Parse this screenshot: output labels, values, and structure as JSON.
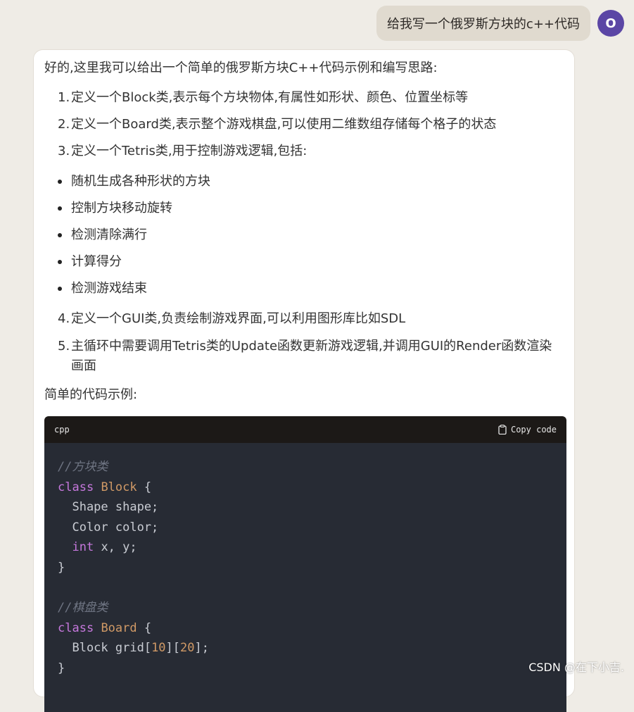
{
  "user_message": {
    "text": "给我写一个俄罗斯方块的c++代码",
    "avatar_initial": "O",
    "avatar_color": "#5b46a5"
  },
  "assistant": {
    "intro": "好的,这里我可以给出一个简单的俄罗斯方块C++代码示例和编写思路:",
    "ordered_items_a": [
      {
        "num": "1.",
        "text": "定义一个Block类,表示每个方块物体,有属性如形状、颜色、位置坐标等"
      },
      {
        "num": "2.",
        "text": "定义一个Board类,表示整个游戏棋盘,可以使用二维数组存储每个格子的状态"
      },
      {
        "num": "3.",
        "text": "定义一个Tetris类,用于控制游戏逻辑,包括:"
      }
    ],
    "bullets": [
      "随机生成各种形状的方块",
      "控制方块移动旋转",
      "检测清除满行",
      "计算得分",
      "检测游戏结束"
    ],
    "ordered_items_b": [
      {
        "num": "4.",
        "text": "定义一个GUI类,负责绘制游戏界面,可以利用图形库比如SDL"
      },
      {
        "num": "5.",
        "text": "主循环中需要调用Tetris类的Update函数更新游戏逻辑,并调用GUI的Render函数渲染画面"
      }
    ],
    "code_label": "简单的代码示例:"
  },
  "code_block": {
    "language": "cpp",
    "copy_label": "Copy code",
    "lines": [
      [
        {
          "t": "//方块类",
          "c": "cm"
        }
      ],
      [
        {
          "t": "class",
          "c": "kw"
        },
        {
          "t": " "
        },
        {
          "t": "Block",
          "c": "ty"
        },
        {
          "t": " {"
        }
      ],
      [
        {
          "t": "  Shape shape;"
        }
      ],
      [
        {
          "t": "  Color color;"
        }
      ],
      [
        {
          "t": "  "
        },
        {
          "t": "int",
          "c": "kw"
        },
        {
          "t": " x, y;"
        }
      ],
      [
        {
          "t": "}"
        }
      ],
      [],
      [
        {
          "t": "//棋盘类",
          "c": "cm"
        }
      ],
      [
        {
          "t": "class",
          "c": "kw"
        },
        {
          "t": " "
        },
        {
          "t": "Board",
          "c": "ty"
        },
        {
          "t": " {"
        }
      ],
      [
        {
          "t": "  Block grid["
        },
        {
          "t": "10",
          "c": "nm"
        },
        {
          "t": "]["
        },
        {
          "t": "20",
          "c": "nm"
        },
        {
          "t": "];"
        }
      ],
      [
        {
          "t": "}"
        }
      ]
    ]
  },
  "watermark": "CSDN @在下小吉."
}
